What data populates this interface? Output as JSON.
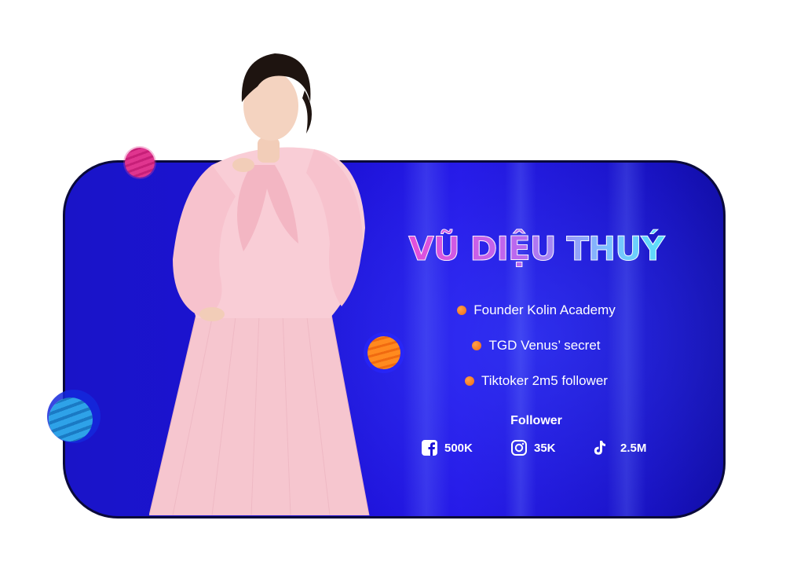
{
  "profile": {
    "name": "VŨ DIỆU THUÝ",
    "roles": [
      "Founder Kolin Academy",
      "TGD Venus’ secret",
      "Tiktoker 2m5 follower"
    ]
  },
  "followers": {
    "title": "Follower",
    "facebook": {
      "icon": "facebook-icon",
      "value": "500K"
    },
    "instagram": {
      "icon": "instagram-icon",
      "value": "35K"
    },
    "tiktok": {
      "icon": "tiktok-icon",
      "value": "2.5M"
    }
  },
  "colors": {
    "card_background": "#1c12d6",
    "name_gradient_start": "#e84ad8",
    "name_gradient_end": "#50e8f8",
    "bullet_dot": "#f57a18",
    "text": "#ffffff"
  }
}
